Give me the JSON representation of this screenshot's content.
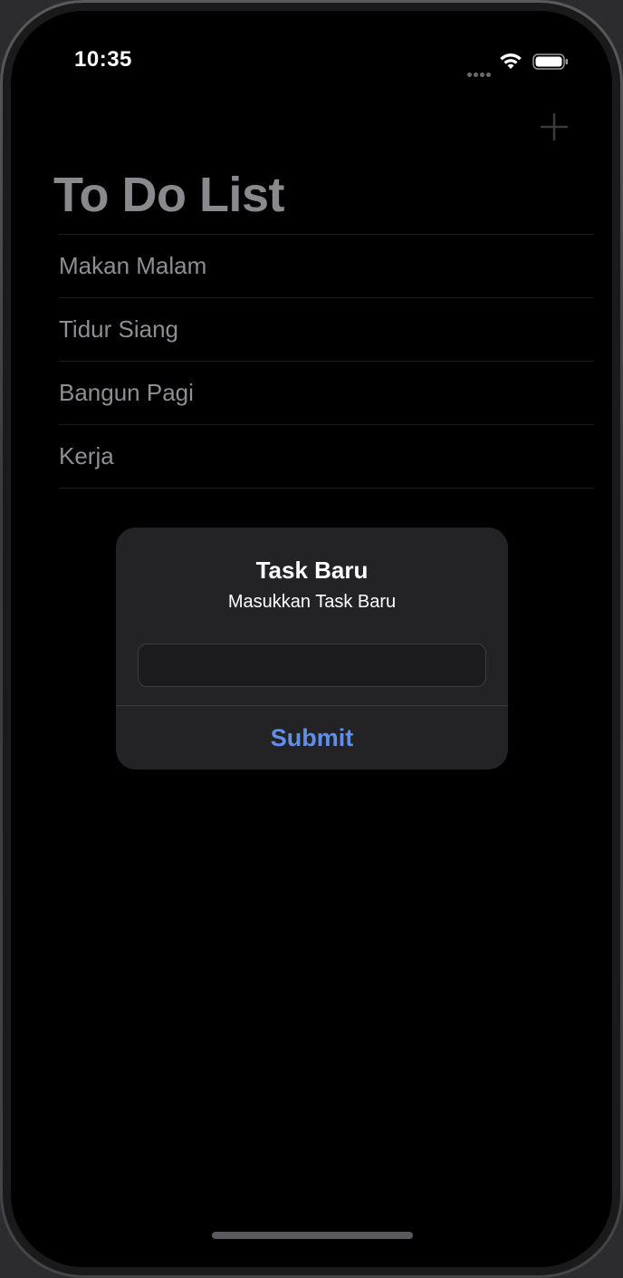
{
  "status_bar": {
    "time": "10:35"
  },
  "nav": {
    "add_icon": "plus-icon",
    "title": "To Do List"
  },
  "tasks": [
    {
      "label": "Makan Malam"
    },
    {
      "label": "Tidur Siang"
    },
    {
      "label": "Bangun Pagi"
    },
    {
      "label": "Kerja"
    }
  ],
  "alert": {
    "title": "Task Baru",
    "message": "Masukkan Task Baru",
    "input_value": "",
    "input_placeholder": "",
    "submit_label": "Submit"
  },
  "colors": {
    "background": "#000000",
    "title_dimmed": "#8a8a8e",
    "alert_background": "#232325",
    "accent": "#5f8fe8"
  }
}
